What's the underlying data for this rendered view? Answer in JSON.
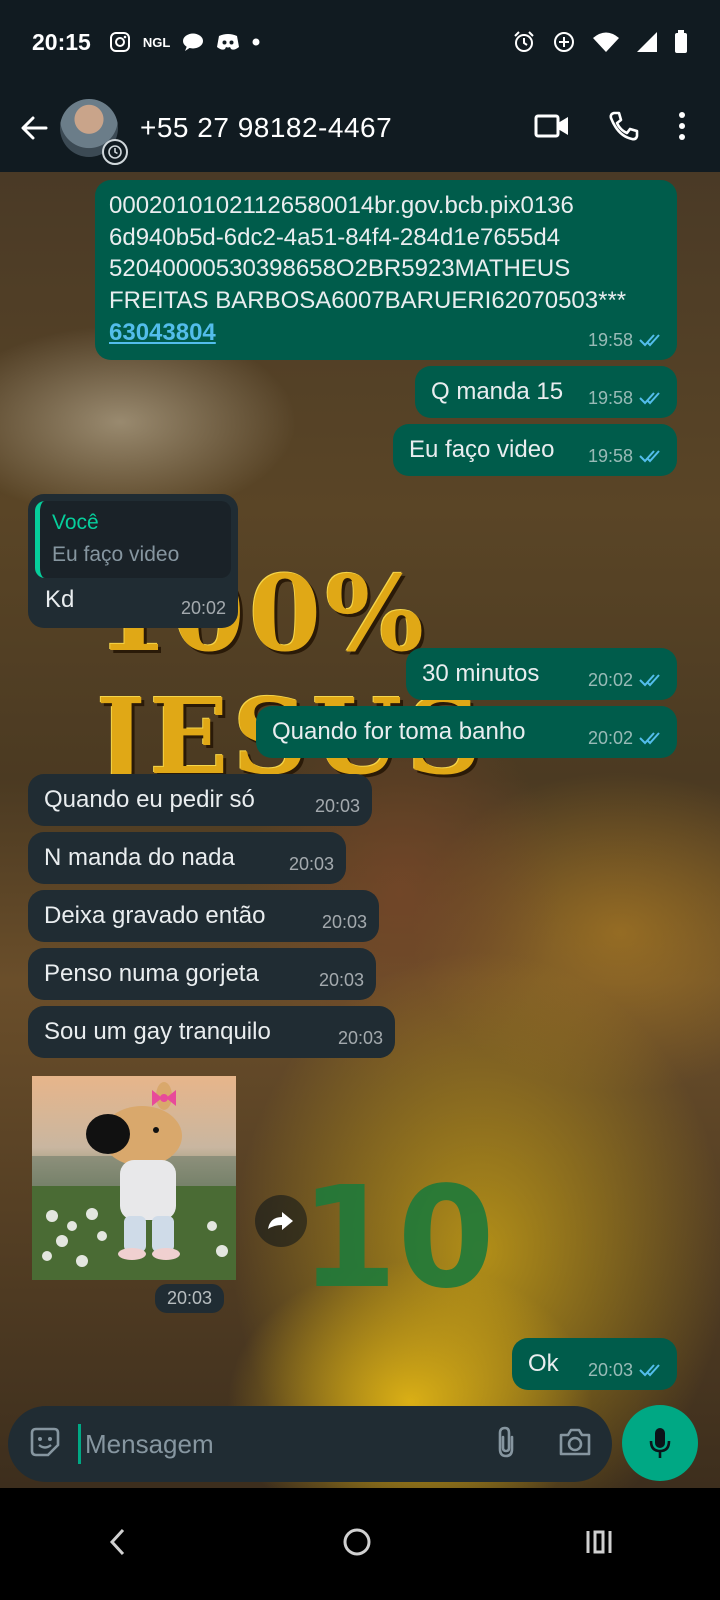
{
  "status_bar": {
    "time": "20:15",
    "notification_icons": [
      "instagram-icon",
      "ngl-icon",
      "chat-icon",
      "discord-icon",
      "dot-icon"
    ],
    "ngl_label": "NGL",
    "system_icons": [
      "alarm-icon",
      "data-saver-icon",
      "wifi-icon",
      "signal-icon",
      "battery-icon"
    ]
  },
  "header": {
    "contact_name": "+55 27 98182-4467"
  },
  "messages": [
    {
      "direction": "out",
      "text": "00020101021126580014br.gov.bcb.pix0136\n6d940b5d-6dc2-4a51-84f4-284d1e7655d4\n52040000530398658O2BR5923MATHEUS\nFREITAS BARBOSA6007BARUERI62070503***",
      "link": "63043804",
      "time": "19:58"
    },
    {
      "direction": "out",
      "text": "Q manda 15",
      "time": "19:58"
    },
    {
      "direction": "out",
      "text": "Eu faço video",
      "time": "19:58"
    },
    {
      "direction": "in",
      "quote_author": "Você",
      "quote_text": "Eu faço video",
      "text": "Kd",
      "time": "20:02"
    },
    {
      "direction": "out",
      "text": "30 minutos",
      "time": "20:02"
    },
    {
      "direction": "out",
      "text": "Quando for toma banho",
      "time": "20:02"
    },
    {
      "direction": "in",
      "text": "Quando eu pedir só",
      "time": "20:03"
    },
    {
      "direction": "in",
      "text": "N manda do nada",
      "time": "20:03"
    },
    {
      "direction": "in",
      "text": "Deixa gravado então",
      "time": "20:03"
    },
    {
      "direction": "in",
      "text": "Penso numa gorjeta",
      "time": "20:03"
    },
    {
      "direction": "in",
      "text": "Sou um gay tranquilo",
      "time": "20:03"
    },
    {
      "direction": "in",
      "type": "sticker",
      "time": "20:03"
    },
    {
      "direction": "out",
      "text": "Ok",
      "time": "20:03"
    }
  ],
  "wallpaper": {
    "headline": "100% JESUS",
    "shirt_number": "10"
  },
  "input": {
    "placeholder": "Mensagem"
  },
  "colors": {
    "outgoing_bubble": "#005c4b",
    "incoming_bubble": "#202c33",
    "read_ticks": "#53bdeb",
    "accent": "#00a884"
  }
}
